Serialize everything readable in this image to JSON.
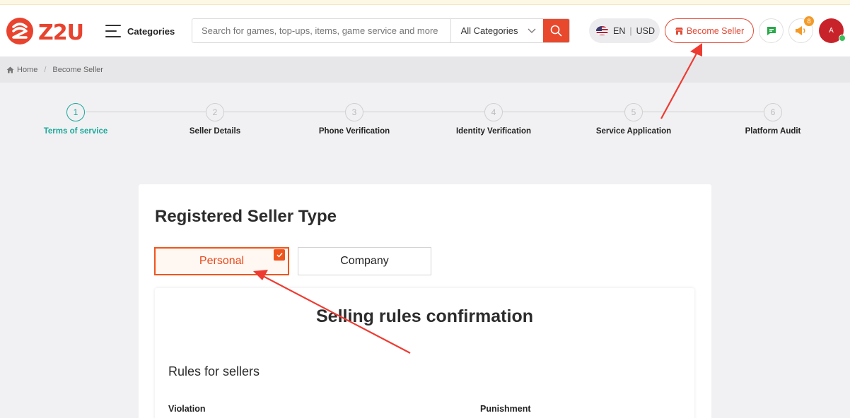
{
  "header": {
    "logo_text": "Z2U",
    "categories_label": "Categories",
    "search_placeholder": "Search for games, top-ups, items, game service and more",
    "category_select": "All Categories",
    "language": "EN",
    "currency": "USD",
    "become_seller_label": "Become Seller",
    "notification_count": "8",
    "avatar_initial": "A"
  },
  "breadcrumb": {
    "home": "Home",
    "current": "Become Seller"
  },
  "steps": [
    {
      "num": "1",
      "label": "Terms of service",
      "active": true
    },
    {
      "num": "2",
      "label": "Seller Details",
      "active": false
    },
    {
      "num": "3",
      "label": "Phone Verification",
      "active": false
    },
    {
      "num": "4",
      "label": "Identity Verification",
      "active": false
    },
    {
      "num": "5",
      "label": "Service Application",
      "active": false
    },
    {
      "num": "6",
      "label": "Platform Audit",
      "active": false
    }
  ],
  "main": {
    "title": "Registered Seller Type",
    "types": [
      {
        "label": "Personal",
        "selected": true
      },
      {
        "label": "Company",
        "selected": false
      }
    ],
    "confirm_title": "Selling rules confirmation",
    "rules_title": "Rules for sellers",
    "columns": [
      "Violation",
      "Punishment"
    ]
  },
  "colors": {
    "brand_red": "#e34a36",
    "active_teal": "#1aa89a",
    "selected_orange": "#f0541d"
  }
}
